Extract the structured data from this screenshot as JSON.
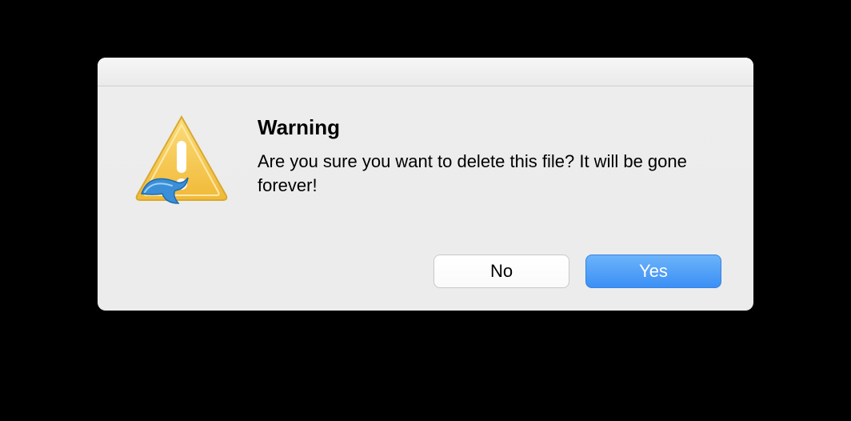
{
  "dialog": {
    "title": "Warning",
    "message": "Are you sure you want to delete this file? It will be gone forever!",
    "buttons": {
      "no_label": "No",
      "yes_label": "Yes"
    },
    "icon": {
      "name": "warning-triangle",
      "badge": "dolphin-app-icon",
      "colors": {
        "triangle_fill": "#f6c545",
        "triangle_stroke": "#d9a92e",
        "exclaim": "#ffffff",
        "dolphin": "#3a8fd8"
      }
    }
  }
}
